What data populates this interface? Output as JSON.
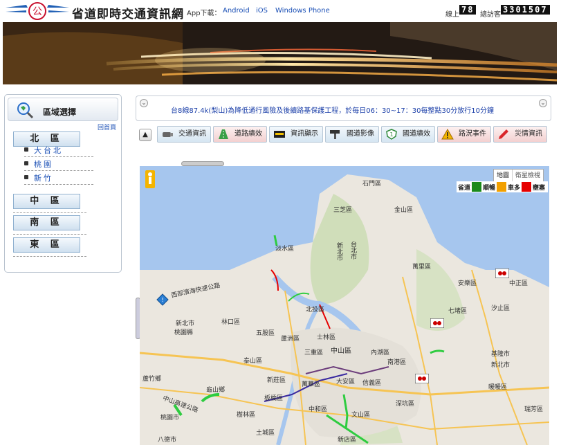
{
  "header": {
    "site_title": "省道即時交通資訊網",
    "app_download_label": "App下載：",
    "app_links": [
      "Android",
      "iOS",
      "Windows Phone"
    ],
    "online_label": "線上",
    "online_count": "78",
    "visits_label": "總訪客",
    "visits_count": "3301507"
  },
  "sidebar": {
    "title": "區域選擇",
    "home_link": "回首頁",
    "regions": [
      "北 區",
      "中 區",
      "南 區",
      "東 區"
    ],
    "north_sub": [
      "大台北",
      "桃園",
      "新竹"
    ]
  },
  "notice": {
    "text": "台8線87.4k(梨山)為降低通行風險及後續路基保護工程，於每日06：30~17：30每整點30分放行10分鐘",
    "prev_icon": "chevron-down-icon",
    "next_icon": "chevron-down-icon"
  },
  "toolbar": {
    "up_icon": "arrow-up-icon",
    "buttons": [
      {
        "label": "交通資訊",
        "icon": "camera-icon"
      },
      {
        "label": "道路績效",
        "icon": "road-icon"
      },
      {
        "label": "資訊顯示",
        "icon": "display-board-icon"
      },
      {
        "label": "國道影像",
        "icon": "cctv-icon"
      },
      {
        "label": "國道績效",
        "icon": "highway-shield-icon"
      },
      {
        "label": "路況事件",
        "icon": "warning-icon"
      },
      {
        "label": "災情資訊",
        "icon": "pencil-icon"
      }
    ]
  },
  "map": {
    "type_buttons": [
      "地圖",
      "衛星檢視"
    ],
    "legend": {
      "title": "省道",
      "items": [
        {
          "label": "順暢",
          "color": "#1a8a1a"
        },
        {
          "label": "車多",
          "color": "#f2a000"
        },
        {
          "label": "壅塞",
          "color": "#e60000"
        }
      ]
    },
    "labels": [
      "石門區",
      "三芝區",
      "金山區",
      "淡水區",
      "新北市",
      "台北市",
      "萬里區",
      "西部濱海快速公路",
      "北投區",
      "林口區",
      "五股區",
      "蘆洲區",
      "士林區",
      "安樂區",
      "中正區",
      "七堵區",
      "汐止區",
      "新北市",
      "桃園縣",
      "三重區",
      "中山區",
      "內湖區",
      "南港區",
      "泰山區",
      "新莊區",
      "萬華區",
      "大安區",
      "信義區",
      "基隆市",
      "新北市",
      "蘆竹鄉",
      "龜山鄉",
      "板橋區",
      "樹林區",
      "中和區",
      "文山區",
      "深坑區",
      "桃園市",
      "八德市",
      "土城區",
      "新店區",
      "暖暖區",
      "瑞芳區",
      "中山高速公路"
    ]
  }
}
